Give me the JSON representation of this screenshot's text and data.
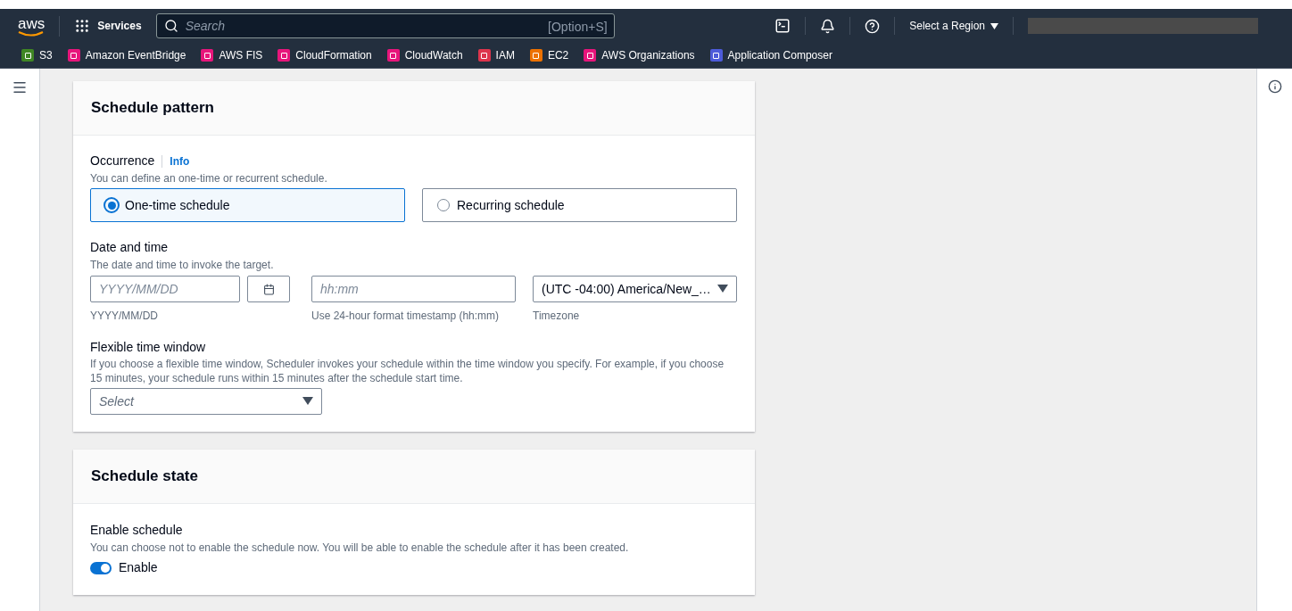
{
  "top_nav": {
    "logo": "aws",
    "services": "Services",
    "search": {
      "placeholder": "Search",
      "shortcut": "[Option+S]"
    },
    "region": "Select a Region"
  },
  "favorites": [
    {
      "label": "S3",
      "color": "#3f8624"
    },
    {
      "label": "Amazon EventBridge",
      "color": "#e7157b"
    },
    {
      "label": "AWS FIS",
      "color": "#e7157b"
    },
    {
      "label": "CloudFormation",
      "color": "#e7157b"
    },
    {
      "label": "CloudWatch",
      "color": "#e7157b"
    },
    {
      "label": "IAM",
      "color": "#dd344c"
    },
    {
      "label": "EC2",
      "color": "#ed7100"
    },
    {
      "label": "AWS Organizations",
      "color": "#e7157b"
    },
    {
      "label": "Application Composer",
      "color": "#4d5bd9"
    }
  ],
  "schedule_pattern": {
    "title": "Schedule pattern",
    "occurrence": {
      "label": "Occurrence",
      "info": "Info",
      "description": "You can define an one-time or recurrent schedule.",
      "options": [
        {
          "label": "One-time schedule",
          "selected": true
        },
        {
          "label": "Recurring schedule",
          "selected": false
        }
      ]
    },
    "date_time": {
      "label": "Date and time",
      "description": "The date and time to invoke the target.",
      "date": {
        "placeholder": "YYYY/MM/DD",
        "hint": "YYYY/MM/DD"
      },
      "time": {
        "placeholder": "hh:mm",
        "hint": "Use 24-hour format timestamp (hh:mm)"
      },
      "timezone": {
        "value": "(UTC -04:00) America/New_…",
        "hint": "Timezone"
      }
    },
    "flexible": {
      "label": "Flexible time window",
      "description": "If you choose a flexible time window, Scheduler invokes your schedule within the time window you specify. For example, if you choose 15 minutes, your schedule runs within 15 minutes after the schedule start time.",
      "select": {
        "placeholder": "Select"
      }
    }
  },
  "schedule_state": {
    "title": "Schedule state",
    "label": "Enable schedule",
    "description": "You can choose not to enable the schedule now. You will be able to enable the schedule after it has been created.",
    "toggle": {
      "label": "Enable",
      "on": true
    }
  }
}
